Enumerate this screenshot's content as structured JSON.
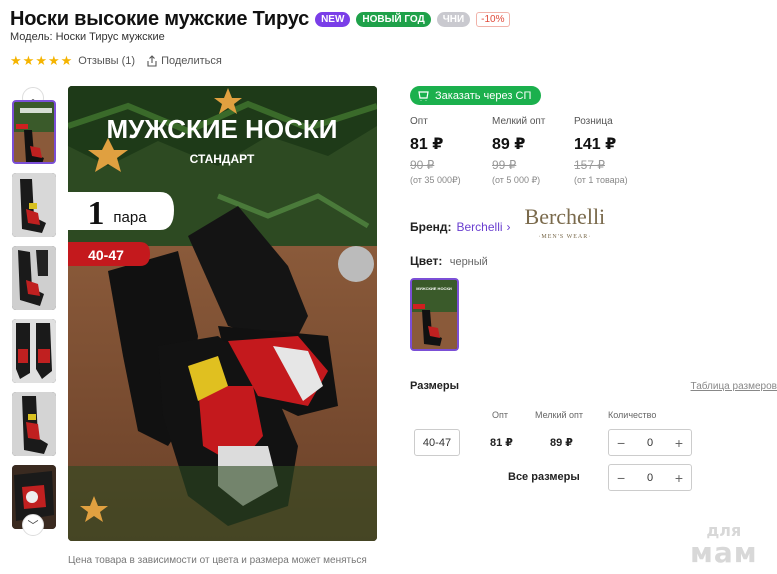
{
  "product": {
    "title": "Носки высокие мужские Тирус",
    "badges": [
      "NEW",
      "НОВЫЙ ГОД",
      "ЧНИ",
      "-10%"
    ],
    "model": "Модель: Носки Тирус мужские",
    "rating_stars": 5,
    "reviews": "Отзывы (1)",
    "share": "Поделиться"
  },
  "image": {
    "banner_title": "МУЖСКИЕ НОСКИ",
    "banner_subtitle": "СТАНДАРТ",
    "pair_count": "1",
    "pair_word": "пара",
    "size_tag": "40-47",
    "caption": "Цена товара в зависимости от цвета и размера может меняться"
  },
  "buy": {
    "sp_button": "Заказать через СП",
    "prices": [
      {
        "label": "Опт",
        "value": "81 ₽",
        "old": "90 ₽",
        "note": "(от 35 000₽)"
      },
      {
        "label": "Мелкий опт",
        "value": "89 ₽",
        "old": "99 ₽",
        "note": "(от 5 000 ₽)"
      },
      {
        "label": "Розница",
        "value": "141 ₽",
        "old": "157 ₽",
        "note": "(от 1 товара)"
      }
    ],
    "brand_label": "Бренд:",
    "brand_name": "Berchelli",
    "brand_logo": "Berchelli",
    "brand_logo_sub": "·MEN'S WEAR·",
    "color_label": "Цвет:",
    "color_value": "черный",
    "swatch_text": "МУЖСКИЕ НОСКИ"
  },
  "sizes": {
    "title": "Размеры",
    "table_link": "Таблица размеров",
    "headers": {
      "opt": "Опт",
      "small_opt": "Мелкий опт",
      "qty": "Количество"
    },
    "rows": [
      {
        "size": "40-47",
        "opt": "81 ₽",
        "small_opt": "89 ₽",
        "qty": "0"
      }
    ],
    "all_sizes_label": "Все размеры",
    "all_sizes_qty": "0",
    "minus": "−",
    "plus": "+"
  },
  "watermark": {
    "line1": "для",
    "line2": "мам"
  },
  "colors": {
    "accent": "#7b4fd6",
    "green": "#1bb04d",
    "new": "#7a3ee8",
    "holiday": "#1fa14a",
    "star": "#f5b400"
  }
}
